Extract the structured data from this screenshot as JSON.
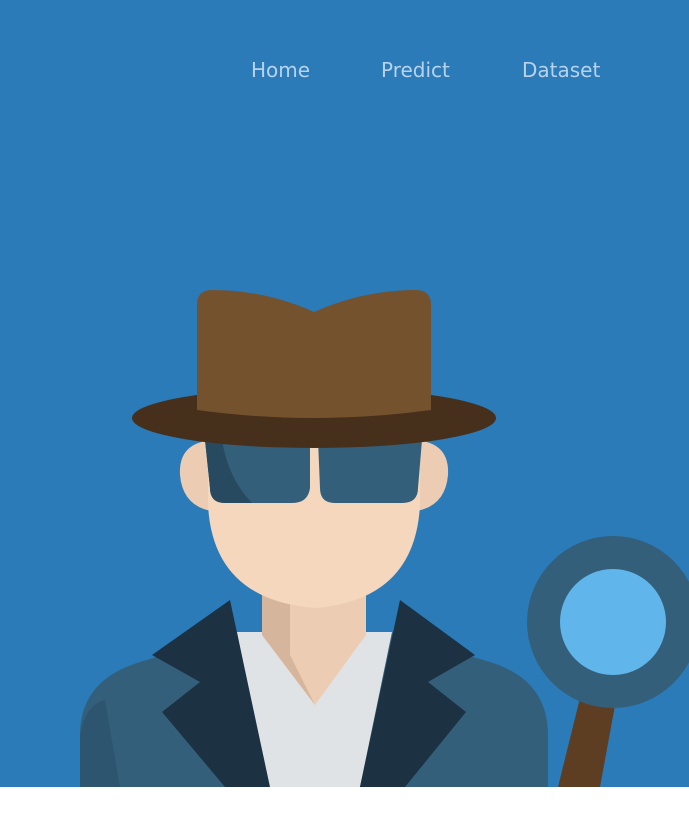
{
  "nav": {
    "items": [
      {
        "label": "Home"
      },
      {
        "label": "Predict"
      },
      {
        "label": "Dataset"
      }
    ]
  },
  "colors": {
    "hero_background": "#2b7bb9",
    "nav_text": "#b8d2ea"
  },
  "hero": {
    "illustration_icon": "detective-icon",
    "magnifier_icon": "magnifying-glass-icon"
  }
}
